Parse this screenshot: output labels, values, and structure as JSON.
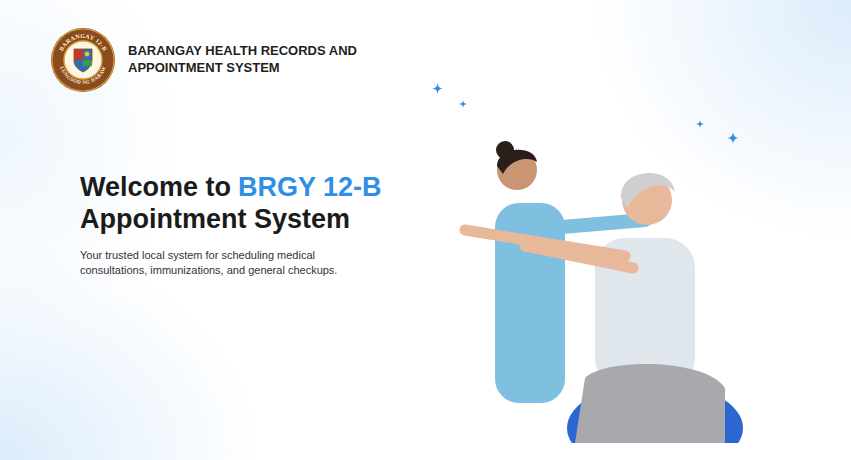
{
  "header": {
    "logo": {
      "top_text": "BARANGAY 12-B",
      "bottom_text": "LUNGSOD NG DABAW"
    },
    "title": "BARANGAY HEALTH RECORDS AND APPOINTMENT SYSTEM"
  },
  "hero": {
    "heading_lead": "Welcome to",
    "heading_highlight": "BRGY 12-B",
    "heading_tail": "Appointment System",
    "subtitle": "Your trusted local system for scheduling medical consultations, immunizations, and general checkups."
  }
}
